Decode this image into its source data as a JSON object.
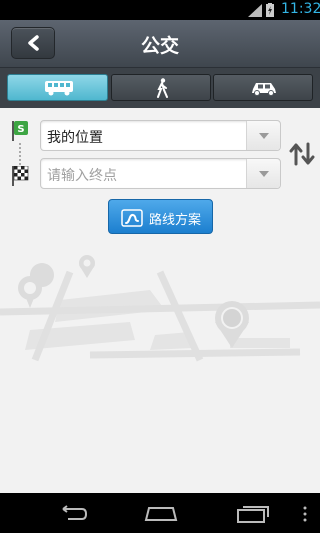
{
  "status_bar": {
    "time": "11:32"
  },
  "header": {
    "title": "公交",
    "back_icon": "back-arrow-icon"
  },
  "tabs": [
    {
      "label": "bus",
      "icon": "bus-icon",
      "active": true
    },
    {
      "label": "walk",
      "icon": "walk-icon",
      "active": false
    },
    {
      "label": "car",
      "icon": "car-icon",
      "active": false
    }
  ],
  "form": {
    "start_value": "我的位置",
    "end_placeholder": "请输入终点",
    "route_button": "路线方案"
  },
  "colors": {
    "accent": "#4fb7cf",
    "button": "#2a8bd7",
    "status_time": "#33b5e5"
  }
}
